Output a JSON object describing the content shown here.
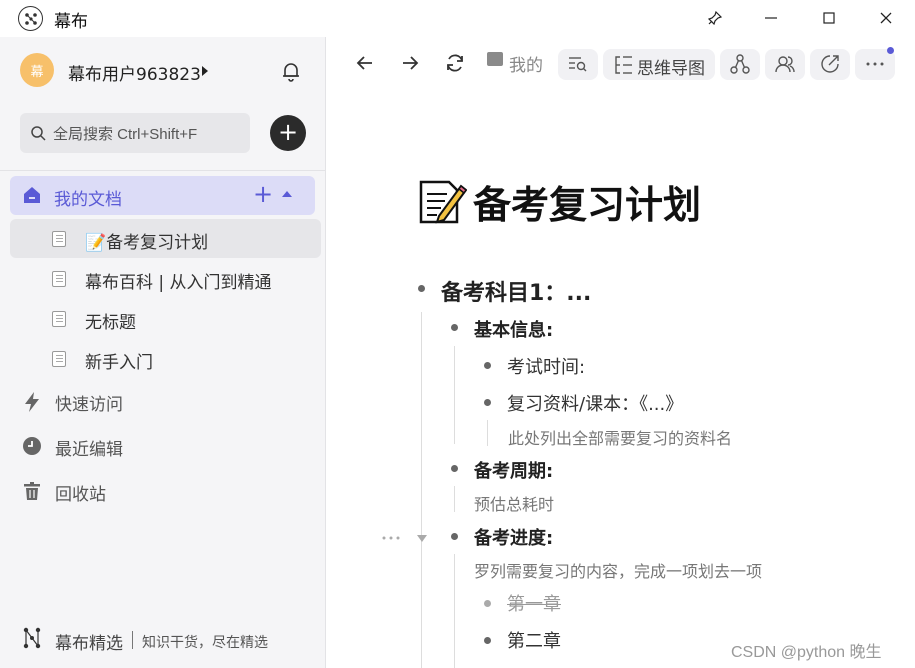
{
  "window": {
    "app_title": "幕布"
  },
  "sidebar": {
    "avatar_text": "幕",
    "username": "幕布用户963823",
    "search_placeholder": "全局搜索 Ctrl+Shift+F",
    "my_docs_label": "我的文档",
    "docs": [
      {
        "label": "📝备考复习计划"
      },
      {
        "label": "幕布百科 | 从入门到精通"
      },
      {
        "label": "无标题"
      },
      {
        "label": "新手入门"
      }
    ],
    "nav": [
      {
        "label": "快速访问"
      },
      {
        "label": "最近编辑"
      },
      {
        "label": "回收站"
      }
    ],
    "footer": {
      "name": "幕布精选",
      "tagline": "知识干货，尽在精选"
    }
  },
  "toolbar": {
    "breadcrumb": "我的",
    "mindmap_label": "思维导图"
  },
  "document": {
    "title": "备考复习计划",
    "outline": {
      "subject": "备考科目1：...",
      "basic_info": "基本信息:",
      "exam_time": "考试时间:",
      "materials": "复习资料/课本：《...》",
      "materials_note": "此处列出全部需要复习的资料名",
      "cycle": "备考周期:",
      "cycle_note": "预估总耗时",
      "progress": "备考进度:",
      "progress_note": "罗列需要复习的内容，完成一项划去一项",
      "chapter1": "第一章",
      "chapter2": "第二章"
    }
  },
  "watermark": "CSDN @python 晚生",
  "colors": {
    "accent": "#5a5ad6",
    "avatar": "#f7c06a"
  }
}
